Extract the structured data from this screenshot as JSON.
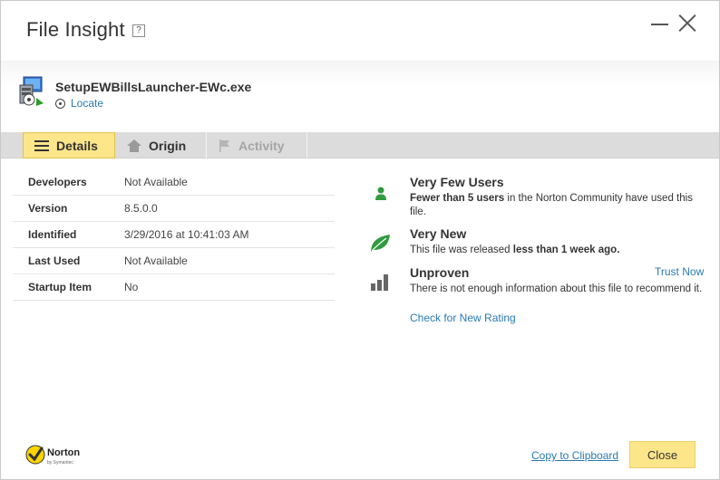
{
  "window": {
    "title": "File Insight",
    "help_label": "?"
  },
  "file": {
    "name": "SetupEWBillsLauncher-EWc.exe",
    "locate_label": "Locate"
  },
  "tabs": [
    {
      "label": "Details",
      "icon": "list-icon",
      "state": "active"
    },
    {
      "label": "Origin",
      "icon": "home-icon",
      "state": "normal"
    },
    {
      "label": "Activity",
      "icon": "flag-icon",
      "state": "disabled"
    }
  ],
  "details": [
    {
      "key": "Developers",
      "value": "Not Available"
    },
    {
      "key": "Version",
      "value": "8.5.0.0"
    },
    {
      "key": "Identified",
      "value": "3/29/2016 at 10:41:03 AM"
    },
    {
      "key": "Last Used",
      "value": "Not Available"
    },
    {
      "key": "Startup Item",
      "value": "No"
    }
  ],
  "insight": {
    "users": {
      "title": "Very Few Users",
      "text_bold": "Fewer than 5 users",
      "text_rest": " in the Norton Community have used this file."
    },
    "age": {
      "title": "Very New",
      "text_pre": "This file was released ",
      "text_bold": "less than 1 week ago."
    },
    "rating": {
      "title": "Unproven",
      "text": "There is not enough information about this file to recommend it.",
      "trust_now": "Trust Now",
      "check_rating": "Check for New Rating"
    }
  },
  "footer": {
    "brand": "Norton",
    "brand_sub": "by Symantec",
    "copy_clipboard": "Copy to Clipboard",
    "close_label": "Close"
  },
  "colors": {
    "accent_yellow": "#fde58a",
    "link_blue": "#2a7ab0",
    "green": "#2f9a3e"
  }
}
